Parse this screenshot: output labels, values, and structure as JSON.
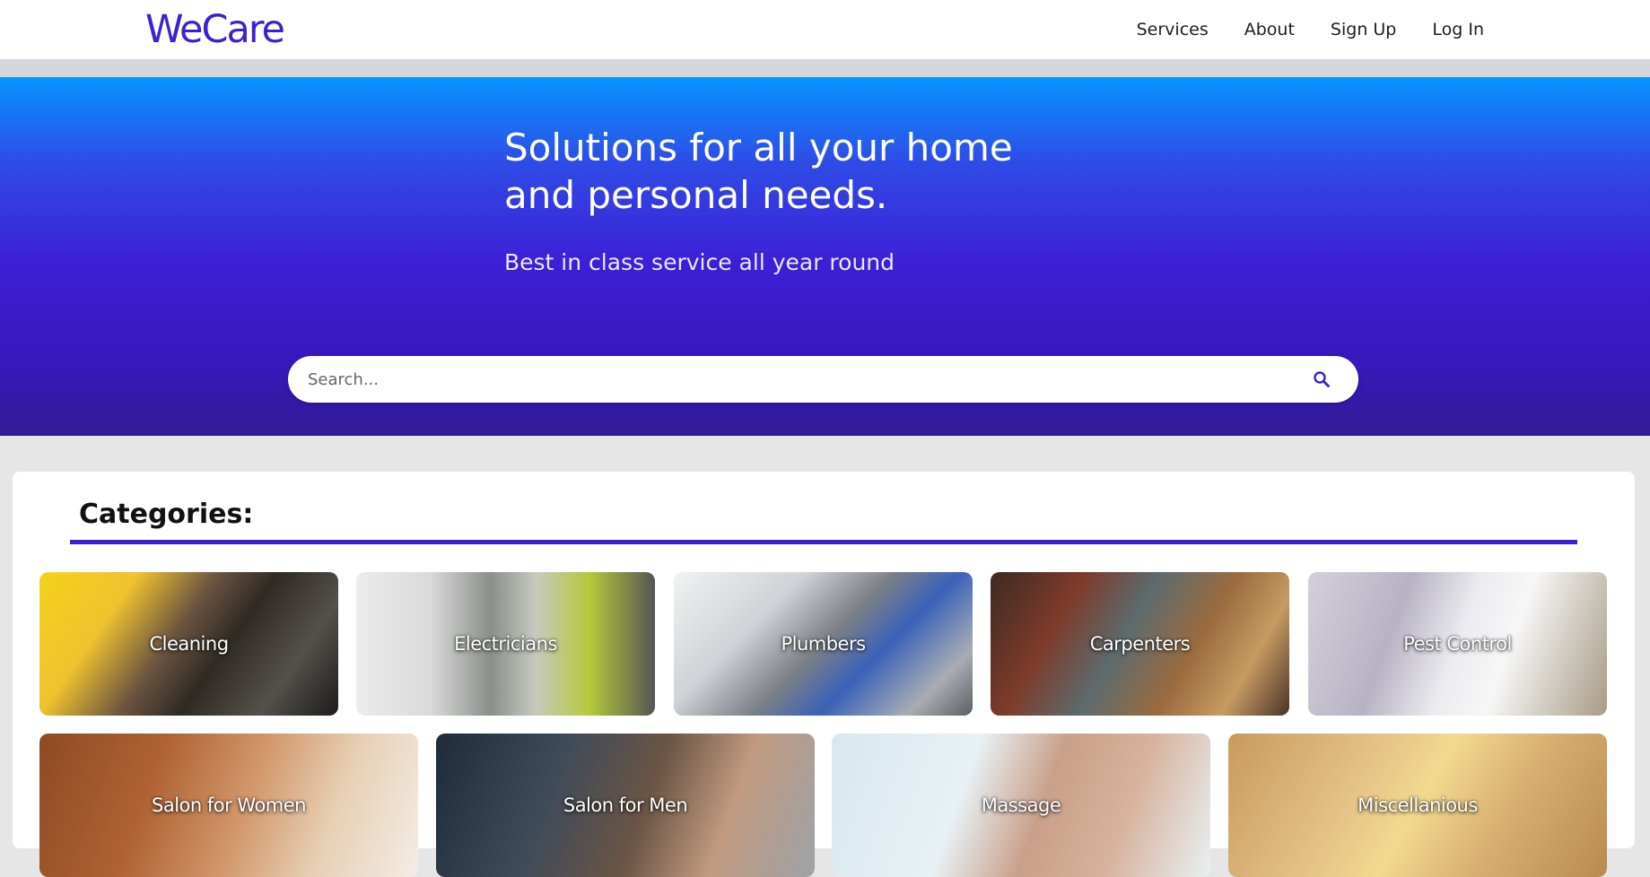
{
  "navbar": {
    "logo": "WeCare",
    "links": [
      "Services",
      "About",
      "Sign Up",
      "Log In"
    ]
  },
  "hero": {
    "title": "Solutions for all your home and personal needs.",
    "subtitle": "Best in class service all year round",
    "search": {
      "placeholder": "Search...",
      "icon": "search-icon"
    }
  },
  "categories": {
    "heading": "Categories:",
    "items": [
      {
        "label": "Cleaning"
      },
      {
        "label": "Electricians"
      },
      {
        "label": "Plumbers"
      },
      {
        "label": "Carpenters"
      },
      {
        "label": "Pest Control"
      },
      {
        "label": "Salon for Women"
      },
      {
        "label": "Salon for Men"
      },
      {
        "label": "Massage"
      },
      {
        "label": "Miscellanious"
      }
    ]
  },
  "colors": {
    "brand": "#3a22d4",
    "hero_top": "#0595ff",
    "hero_bottom": "#311c96",
    "accent_rule": "#3a1fd6"
  }
}
